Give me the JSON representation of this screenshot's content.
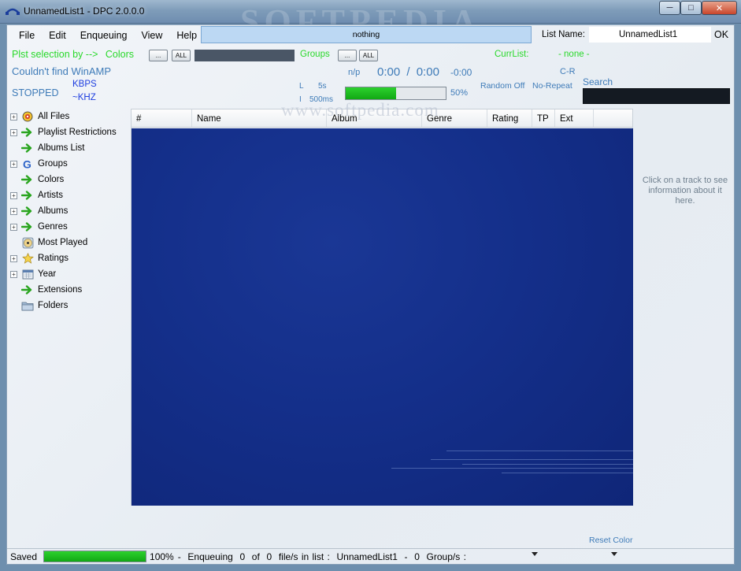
{
  "window": {
    "title": "UnnamedList1 - DPC 2.0.0.0",
    "watermark": "SOFTPEDIA"
  },
  "menu": {
    "items": [
      "File",
      "Edit",
      "Enqueuing",
      "View",
      "Help"
    ]
  },
  "now_playing": "nothing",
  "list_name": {
    "label": "List Name:",
    "value": "UnnamedList1",
    "ok": "OK"
  },
  "selection": {
    "plst_label": "Plst selection by -->",
    "colors_label": "Colors",
    "dots": "...",
    "all": "ALL",
    "groups_label": "Groups",
    "currlist_label": "CurrList:",
    "currlist_value": "- none -"
  },
  "player": {
    "message": "Couldn't find WinAMP",
    "np_label": "n/p",
    "elapsed": "0:00",
    "separator": "/",
    "total": "0:00",
    "remaining": "-0:00",
    "cr": "C-R",
    "state": "STOPPED",
    "kbps": "KBPS",
    "khz": "~KHZ",
    "l_label": "L",
    "l_value": "5s",
    "i_label": "I",
    "i_value": "500ms",
    "volume_pct": 50,
    "volume_text": "50%",
    "random": "Random Off",
    "repeat": "No-Repeat",
    "search_label": "Search",
    "search_value": ""
  },
  "tree": [
    {
      "label": "All Files",
      "expandable": true,
      "icon": "winamp-icon"
    },
    {
      "label": "Playlist Restrictions",
      "expandable": true,
      "icon": "green-arrow-icon"
    },
    {
      "label": "Albums List",
      "expandable": false,
      "icon": "green-arrow-icon"
    },
    {
      "label": "Groups",
      "expandable": true,
      "icon": "g-letter-icon"
    },
    {
      "label": "Colors",
      "expandable": false,
      "icon": "green-arrow-icon"
    },
    {
      "label": "Artists",
      "expandable": true,
      "icon": "green-arrow-icon"
    },
    {
      "label": "Albums",
      "expandable": true,
      "icon": "green-arrow-icon"
    },
    {
      "label": "Genres",
      "expandable": true,
      "icon": "green-arrow-icon"
    },
    {
      "label": "Most Played",
      "expandable": false,
      "icon": "cd-icon"
    },
    {
      "label": "Ratings",
      "expandable": true,
      "icon": "star-icon"
    },
    {
      "label": "Year",
      "expandable": true,
      "icon": "calendar-icon"
    },
    {
      "label": "Extensions",
      "expandable": false,
      "icon": "green-arrow-icon"
    },
    {
      "label": "Folders",
      "expandable": false,
      "icon": "folder-icon"
    }
  ],
  "columns": [
    "#",
    "Name",
    "Album",
    "Genre",
    "Rating",
    "TP",
    "Ext"
  ],
  "track_info": "Click on a track to see information about it here.",
  "reset_color": "Reset Color",
  "status": {
    "saved": "Saved",
    "progress_pct": 100,
    "progress_text": "100%",
    "text": "-  Enqueuing  0  of  0  file/s in list :  UnnamedList1  -  0  Group/s :"
  }
}
